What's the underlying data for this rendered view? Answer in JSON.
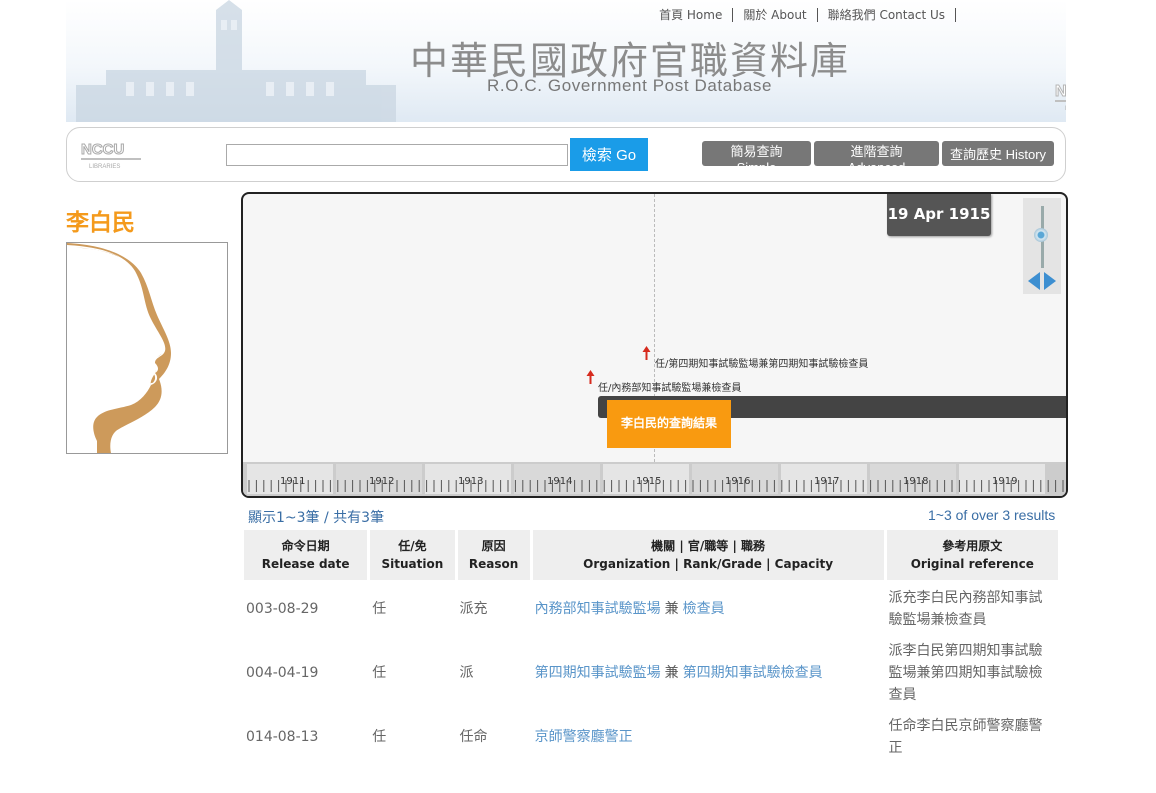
{
  "header": {
    "nav": [
      "首頁 Home",
      "關於 About",
      "聯絡我們 Contact Us"
    ],
    "title_zh": "中華民國政府官職資料庫",
    "title_en": "R.O.C. Government Post Database",
    "logo_text": "NCCU",
    "logo_sub": "LIBRARIES"
  },
  "search": {
    "input_value": "",
    "go_label": "檢索 Go",
    "buttons": [
      "簡易查詢 Simple",
      "進階查詢 Advanced",
      "查詢歷史 History"
    ]
  },
  "person": {
    "name": "李白民"
  },
  "timeline": {
    "current_date": "19 Apr 1915",
    "events": [
      "任/第四期知事試驗監場兼第四期知事試驗檢查員",
      "任/內務部知事試驗監場兼檢查員"
    ],
    "result_label": "李白民的查詢結果",
    "years": [
      "1911",
      "1912",
      "1913",
      "1914",
      "1915",
      "1916",
      "1917",
      "1918",
      "1919"
    ]
  },
  "results": {
    "count_zh": "顯示1~3筆 / 共有3筆",
    "count_en": "1~3 of over 3 results",
    "columns": [
      {
        "zh": "命令日期",
        "en": "Release date"
      },
      {
        "zh": "任/免",
        "en": "Situation"
      },
      {
        "zh": "原因",
        "en": "Reason"
      },
      {
        "zh": "機關 | 官/職等 | 職務",
        "en": "Organization | Rank/Grade | Capacity"
      },
      {
        "zh": "參考用原文",
        "en": "Original reference"
      }
    ],
    "rows": [
      {
        "date": "003-08-29",
        "situation": "任",
        "reason": "派充",
        "org1": "內務部知事試驗監場",
        "and": "兼",
        "org2": "檢查員",
        "original": "派充李白民內務部知事試驗監場兼檢查員"
      },
      {
        "date": "004-04-19",
        "situation": "任",
        "reason": "派",
        "org1": "第四期知事試驗監場",
        "and": "兼",
        "org2": "第四期知事試驗檢查員",
        "original": "派李白民第四期知事試驗監場兼第四期知事試驗檢查員"
      },
      {
        "date": "014-08-13",
        "situation": "任",
        "reason": "任命",
        "org1": "京師警察廳警正",
        "and": "",
        "org2": "",
        "original": "任命李白民京師警察廳警正"
      }
    ]
  },
  "colors": {
    "accent_orange": "#f49a1c",
    "link_blue": "#5a95c9",
    "go_button": "#1a9ce8",
    "nav_button": "#777777"
  }
}
